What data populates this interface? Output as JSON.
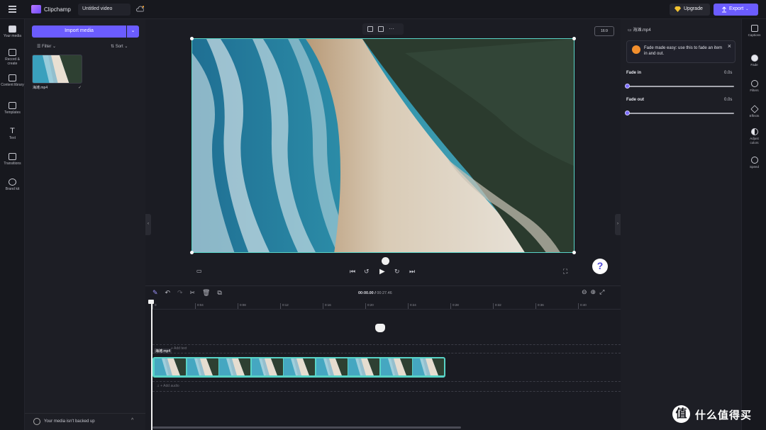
{
  "header": {
    "app_name": "Clipchamp",
    "video_title": "Untitled video",
    "upgrade_label": "Upgrade",
    "export_label": "Export"
  },
  "left_rail": [
    {
      "label": "Your media",
      "icon": "folder-icon",
      "active": true
    },
    {
      "label": "Record & create",
      "icon": "camera-icon"
    },
    {
      "label": "Content library",
      "icon": "library-icon"
    },
    {
      "label": "Templates",
      "icon": "templates-icon"
    },
    {
      "label": "Text",
      "icon": "text-icon"
    },
    {
      "label": "Transitions",
      "icon": "transitions-icon"
    },
    {
      "label": "Brand kit",
      "icon": "brand-kit-icon"
    }
  ],
  "media": {
    "import_label": "Import media",
    "filter_label": "Filter",
    "sort_label": "Sort",
    "file_name": "海滩.mp4",
    "backup_text": "Your media isn't backed up"
  },
  "stage": {
    "aspect_ratio": "16:9"
  },
  "right_panel": {
    "file_name": "海滩.mp4",
    "tip_text": "Fade made easy: use this to fade an item in and out.",
    "fade_in_label": "Fade in",
    "fade_in_value": "0.0s",
    "fade_out_label": "Fade out",
    "fade_out_value": "0.0s"
  },
  "right_rail": [
    {
      "label": "Captions",
      "icon": "captions-icon"
    },
    {
      "label": "Fade",
      "icon": "fade-icon",
      "active": true
    },
    {
      "label": "Filters",
      "icon": "filters-icon"
    },
    {
      "label": "Effects",
      "icon": "effects-icon"
    },
    {
      "label": "Adjust colors",
      "icon": "adjust-colors-icon"
    },
    {
      "label": "Speed",
      "icon": "speed-icon"
    }
  ],
  "timeline": {
    "current_time": "00:00.00",
    "total_time": "00:27.46",
    "ticks": [
      "0",
      "0:04",
      "0:08",
      "0:12",
      "0:16",
      "0:20",
      "0:24",
      "0:28",
      "0:32",
      "0:36",
      "0:40"
    ],
    "text_lane_hint": "+ Add text",
    "clip_label": "海滩.mp4",
    "audio_lane_hint": "+ Add audio"
  },
  "watermark": {
    "glyph": "值",
    "text": "什么值得买"
  },
  "colors": {
    "accent": "#6b5cff",
    "selection": "#58d3c6",
    "background": "#15161c"
  }
}
